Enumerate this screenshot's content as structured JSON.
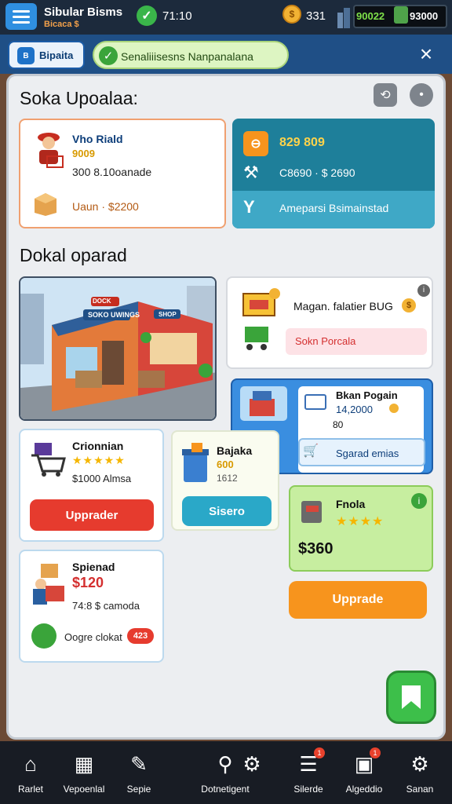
{
  "topbar": {
    "app_title": "Sibular Bisms",
    "app_subtitle": "Bicaca $",
    "clock_value": "71:10",
    "coins_value": "331",
    "cash_value": "90022",
    "cash_value_2": "93000"
  },
  "subbar": {
    "tab_label": "Bipaita",
    "tab_icon": "B",
    "notification_text": "Senaliiisesns Nanpanalana",
    "close_icon": "close-icon"
  },
  "header": {
    "title": "Soka Upoalaa:"
  },
  "staff_card": {
    "name": "Vho Riald",
    "rating_text": "9009",
    "stat_line": "300 8.10oanade",
    "item_line": "Uaun · $2200"
  },
  "finance_card": {
    "amount": "829 809",
    "range": "C8690 · $ 2690",
    "status": "Ameparsi Bsimainstad"
  },
  "section2": {
    "title": "Dokal oparad"
  },
  "store_image": {
    "sign_top": "DOCK",
    "sign_main": "SOKO UWINGS",
    "sign_side": "SHOP"
  },
  "magazine_card": {
    "title": "Magan. falatier BUG",
    "coin": "$",
    "pill": "Sokn Porcala"
  },
  "blue_card": {
    "title": "Bkan Pogain",
    "amount": "14,2000",
    "sub": "80",
    "pill": "Sgarad emias"
  },
  "cart_card": {
    "title": "Crionnian",
    "stars": "★★★★★",
    "price": "$1000 Almsa",
    "button": "Upprader"
  },
  "bin_card": {
    "title": "Bajaka",
    "value1": "600",
    "value2": "1612",
    "button": "Sisero"
  },
  "green_card": {
    "title": "Fnola",
    "stars": "★★★★",
    "price": "$360",
    "info": "i"
  },
  "orange_button": {
    "label": "Upprade"
  },
  "box_card": {
    "title": "Spienad",
    "price": "$120",
    "detail": "74:8 $ camoda",
    "pill_text": "Oogre clokat",
    "badge": "423"
  },
  "fab": {
    "icon": "bookmark-icon"
  },
  "nav": [
    {
      "label": "Rarlet",
      "icon": "home-icon"
    },
    {
      "label": "Vepoenlal",
      "icon": "store-icon"
    },
    {
      "label": "Sepie",
      "icon": "pen-icon"
    },
    {
      "label": "Dotnetigent",
      "icon": "wrench-icon"
    },
    {
      "label": "",
      "icon": "gear-icon"
    },
    {
      "label": "Silerde",
      "icon": "list-icon",
      "badge": "1"
    },
    {
      "label": "Algeddio",
      "icon": "photo-icon",
      "badge": "1"
    },
    {
      "label": "Sanan",
      "icon": "settings-icon"
    }
  ],
  "colors": {
    "topbar": "#1c2a3c",
    "subbar": "#1f4f86",
    "panel": "#eceef1",
    "teal": "#1e7f9a",
    "blue": "#3a8ee0",
    "red_button": "#e63b2e",
    "cyan_button": "#2aa8c8",
    "orange_button": "#f7941d",
    "green": "#3dbf4a"
  }
}
